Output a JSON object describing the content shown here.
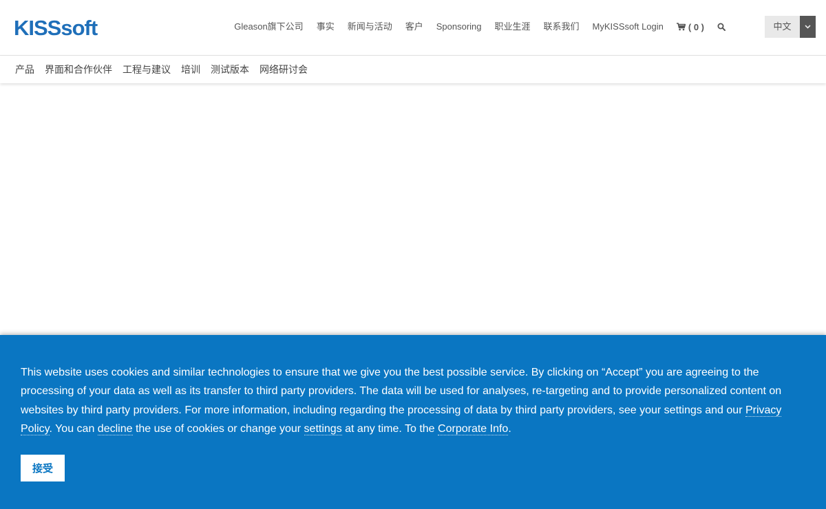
{
  "header": {
    "logo_text": "KISSsoft",
    "nav": [
      {
        "id": "gleason",
        "label": "Gleason旗下公司"
      },
      {
        "id": "facts",
        "label": "事实"
      },
      {
        "id": "news",
        "label": "新闻与活动"
      },
      {
        "id": "customers",
        "label": "客户"
      },
      {
        "id": "sponsoring",
        "label": "Sponsoring"
      },
      {
        "id": "career",
        "label": "职业生涯"
      },
      {
        "id": "contact",
        "label": "联系我们"
      },
      {
        "id": "login",
        "label": "MyKISSsoft Login"
      }
    ],
    "cart_label": "( 0 )",
    "language": "中文",
    "colors": {
      "logo": "#1f6fb9",
      "nav_text": "#555555"
    }
  },
  "subnav": {
    "items": [
      {
        "id": "products",
        "label": "产品"
      },
      {
        "id": "interfaces",
        "label": "界面和合作伙伴"
      },
      {
        "id": "engineering",
        "label": "工程与建议"
      },
      {
        "id": "training",
        "label": "培训"
      },
      {
        "id": "trial",
        "label": "测试版本"
      },
      {
        "id": "webinar",
        "label": "网络研讨会"
      }
    ]
  },
  "cookie_banner": {
    "text_1": "This website uses cookies and similar technologies to ensure that we give you the best possible service. By clicking on “Accept” you are agreeing to the processing of your data as well as its transfer to third party providers. The data will be used for analyses, re-targeting and to provide personalized content on websites by third party providers. For more information, including regarding the processing of data by third party providers, see your settings and our ",
    "privacy_link": "Privacy Policy",
    "text_2": ". You can ",
    "decline_link": "decline",
    "text_3": " the use of cookies or change your ",
    "settings_link": "settings",
    "text_4": " at any time. To the ",
    "corporate_link": "Corporate Info",
    "text_5": ".",
    "accept_label": "接受",
    "colors": {
      "background": "#0a76c2",
      "text": "#ffffff"
    }
  }
}
